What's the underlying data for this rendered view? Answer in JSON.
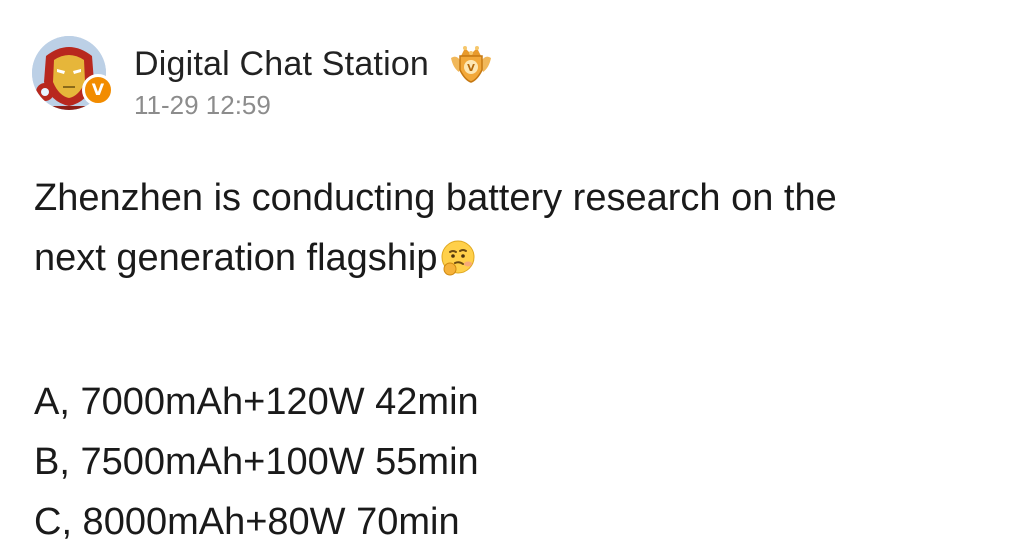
{
  "post": {
    "author": {
      "name": "Digital Chat Station",
      "avatar_icon": "iron-man-avatar",
      "verified_badge": "V",
      "verified_color": "#f28c00",
      "vip_icon": "crown-icon"
    },
    "timestamp": "11-29 12:59",
    "text": {
      "line1": "Zhenzhen is conducting battery research on the",
      "line2": "next generation flagship",
      "emoji": "thinking-face-emoji"
    },
    "options": [
      "A, 7000mAh+120W 42min",
      "B, 7500mAh+100W 55min",
      "C, 8000mAh+80W 70min"
    ]
  }
}
